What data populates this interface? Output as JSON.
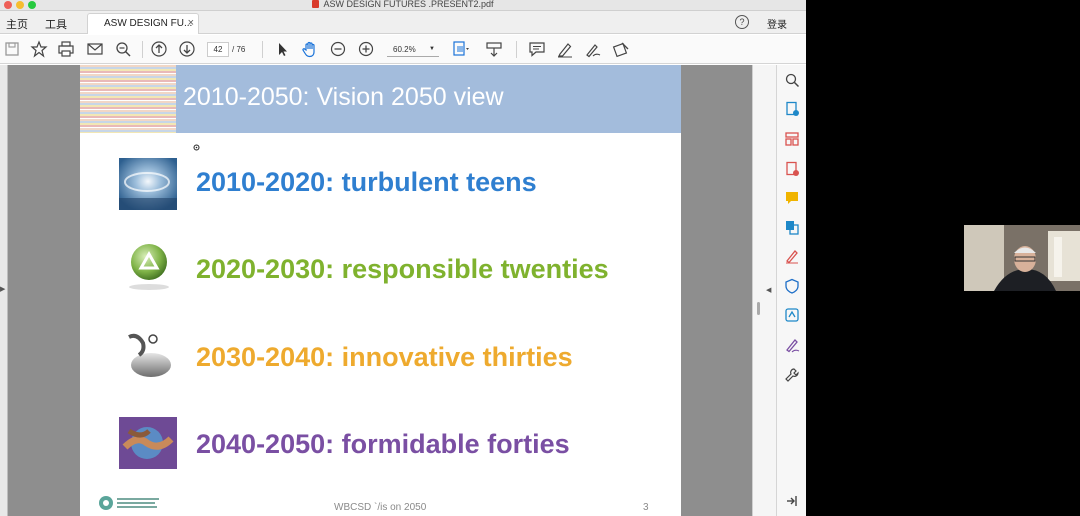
{
  "window": {
    "title": "ASW DESIGN FUTURES .PRESENT2.pdf"
  },
  "tabs": {
    "home": "主页",
    "tools": "工具",
    "document": "ASW DESIGN FU...",
    "close": "×",
    "help": "?",
    "login": "登录"
  },
  "toolbar": {
    "page_current": "42",
    "page_total": "/ 76",
    "zoom": "60.2%"
  },
  "slide": {
    "title": "2010-2050: Vision 2050 view",
    "eras": [
      {
        "text": "2010-2020: turbulent teens",
        "color": "#2f7fd0"
      },
      {
        "text": "2020-2030: responsible twenties",
        "color": "#7fb22e"
      },
      {
        "text": "2030-2040: innovative thirties",
        "color": "#eeaa2e"
      },
      {
        "text": "2040-2050: formidable forties",
        "color": "#7a4fa3"
      }
    ],
    "footer": "WBCSD `/is on 2050",
    "slide_number": "3"
  },
  "colors": {
    "banner": "#a3bcdc",
    "accent_red": "#d93a2b"
  }
}
